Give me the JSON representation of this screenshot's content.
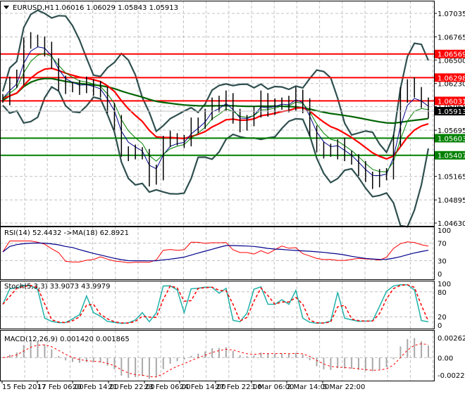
{
  "header": {
    "symbol": "EURUSD,H1",
    "ohlc": "1.06016 1.06029 1.05843 1.05913"
  },
  "price_axis": {
    "ticks": [
      "1.07035",
      "1.06765",
      "1.06500",
      "1.06230",
      "1.05965",
      "1.05695",
      "1.05165",
      "1.04895",
      "1.04630"
    ],
    "tick_values": [
      1.07035,
      1.06765,
      1.065,
      1.0623,
      1.05965,
      1.05695,
      1.05165,
      1.04895,
      1.0463
    ],
    "range": [
      1.0463,
      1.07035
    ]
  },
  "levels": [
    {
      "label": "1.06569",
      "value": 1.06569,
      "color": "#ff0000"
    },
    {
      "label": "1.06298",
      "value": 1.06298,
      "color": "#ff0000"
    },
    {
      "label": "1.06031",
      "value": 1.06031,
      "color": "#ff0000"
    },
    {
      "label": "1.05603",
      "value": 1.05603,
      "color": "#008000"
    },
    {
      "label": "1.05407",
      "value": 1.05407,
      "color": "#008000"
    }
  ],
  "current_price": {
    "label": "1.05913",
    "value": 1.05913,
    "color": "#000000"
  },
  "closes": [
    1.0606,
    1.0624,
    1.063,
    1.067,
    1.0674,
    1.067,
    1.0662,
    1.0646,
    1.0624,
    1.0618,
    1.062,
    1.0618,
    1.0622,
    1.0618,
    1.0614,
    1.0594,
    1.0578,
    1.0545,
    1.0543,
    1.0545,
    1.0541,
    1.0513,
    1.0521,
    1.0557,
    1.0561,
    1.0557,
    1.0557,
    1.0575,
    1.0578,
    1.0586,
    1.0602,
    1.0598,
    1.0606,
    1.0586,
    1.0574,
    1.0582,
    1.059,
    1.0606,
    1.0594,
    1.0598,
    1.0602,
    1.0598,
    1.061,
    1.0598,
    1.057,
    1.0549,
    1.0545,
    1.0545,
    1.0553,
    1.0541,
    1.0535,
    1.0525,
    1.0516,
    1.0511,
    1.0517,
    1.0521,
    1.0557,
    1.061,
    1.0622,
    1.0614,
    1.06,
    1.0591
  ],
  "colors": {
    "bollinger": "#2f4f4f",
    "ma_long": "#006400",
    "ma_mid": "#ff0000",
    "ma_fast_blue": "#00008b",
    "ma_fast_green": "#008000",
    "candles": "#000000"
  },
  "rsi": {
    "title": "RSI(14) 52.4432  ->MA(18) 62.8921",
    "ticks": [
      "100",
      "70",
      "30",
      "0"
    ],
    "tick_values": [
      100,
      70,
      30,
      0
    ]
  },
  "stoch": {
    "title": "Stoch(5,3,3) 33.9073 43.9979",
    "ticks": [
      "100",
      "80",
      "20",
      "0"
    ],
    "tick_values": [
      100,
      80,
      20,
      0
    ]
  },
  "macd": {
    "title": "MACD(12,26,9) 0.001420 0.001865",
    "ticks": [
      "0.00262",
      "0.00",
      "-0.002274"
    ],
    "tick_values": [
      0.00262,
      0,
      -0.002274
    ]
  },
  "time_axis": [
    "15 Feb 2017",
    "17 Feb 06:00",
    "20 Feb 14:00",
    "21 Feb 22:00",
    "23 Feb 06:00",
    "24 Feb 14:00",
    "27 Feb 22:00",
    "1 Mar 06:00",
    "2 Mar 14:00",
    "5 Mar 22:00"
  ]
}
